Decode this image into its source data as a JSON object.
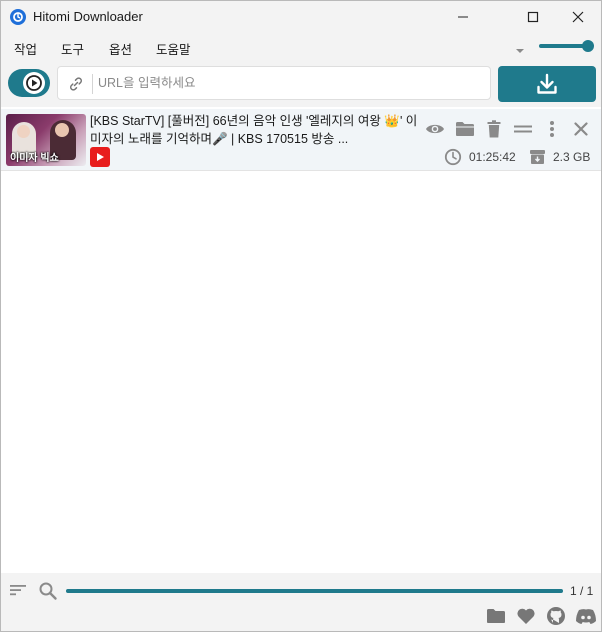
{
  "window": {
    "title": "Hitomi Downloader"
  },
  "menu": {
    "items": [
      {
        "label": "작업"
      },
      {
        "label": "도구"
      },
      {
        "label": "옵션"
      },
      {
        "label": "도움말"
      }
    ]
  },
  "toolbar": {
    "url_placeholder": "URL을 입력하세요",
    "url_value": ""
  },
  "downloads": [
    {
      "title": "[KBS StarTV] [풀버전] 66년의 음악 인생 '엘레지의 여왕 👑' 이미자의 노래를 기억하며🎤 | KBS 170515 방송 ...",
      "thumbnail_caption": "이미자 빅쇼",
      "source": "youtube",
      "duration": "01:25:42",
      "size": "2.3 GB"
    }
  ],
  "bottom": {
    "page_count": "1 / 1",
    "progress": 1.0
  },
  "colors": {
    "accent": "#1f7a8c",
    "youtube": "#e81d1d",
    "titlebar_bg": "#f3f3f3"
  },
  "icons": {
    "app": "hitomi-app-icon",
    "toggle": "play-icon",
    "url": "link-icon",
    "download": "download-icon",
    "row_actions": [
      "eye-icon",
      "folder-icon",
      "trash-icon",
      "equals-icon",
      "more-vertical-icon",
      "close-icon"
    ],
    "bottom_left": [
      "sort-icon",
      "search-icon"
    ],
    "bottom_right": [
      "folder-icon",
      "heart-icon",
      "github-icon",
      "discord-icon"
    ]
  }
}
